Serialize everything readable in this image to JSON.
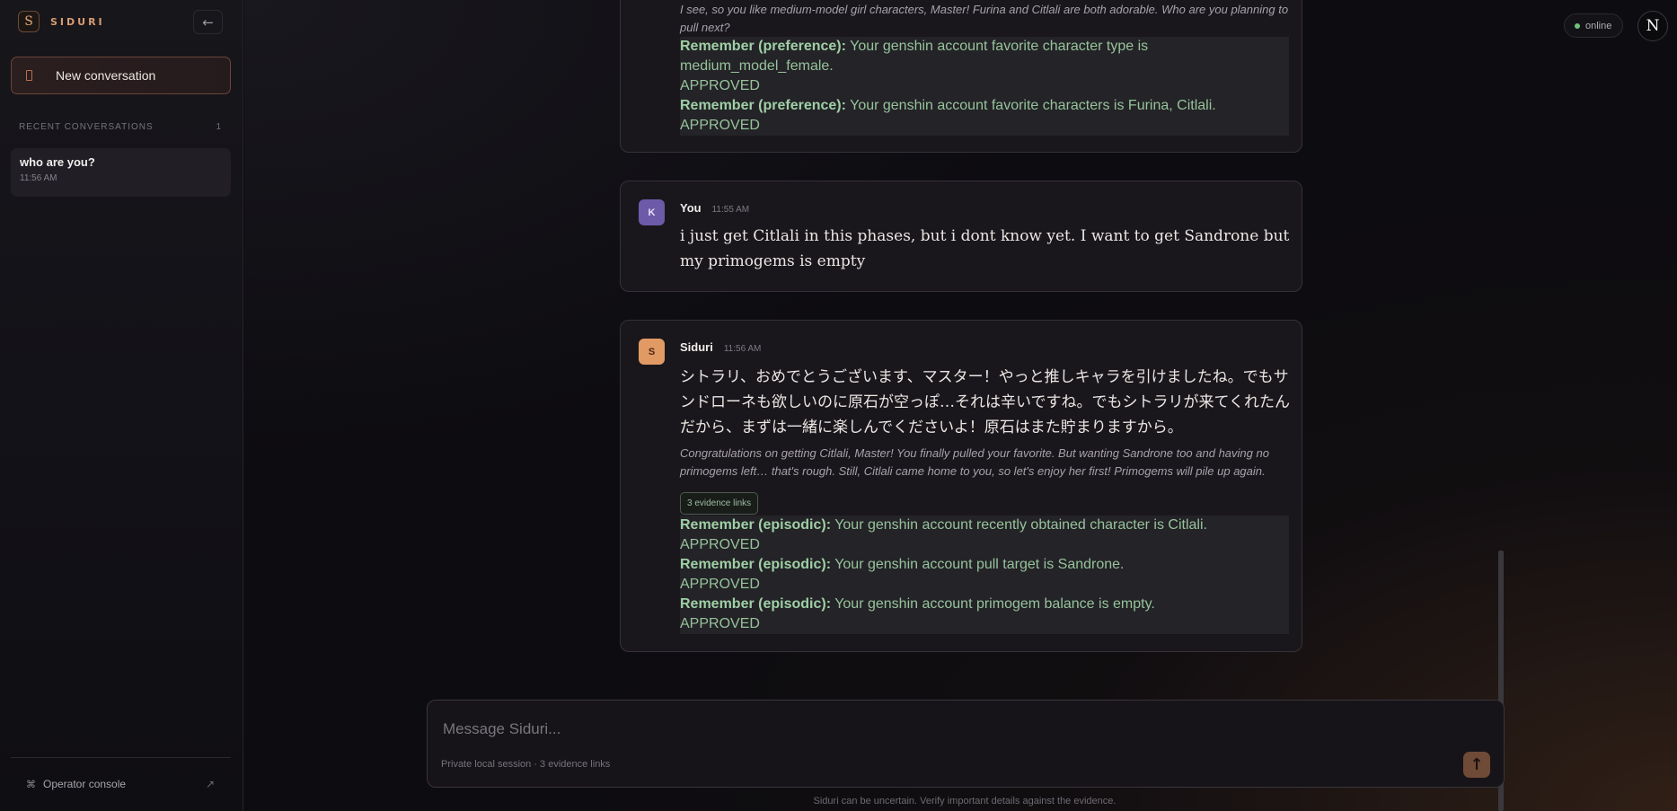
{
  "brand": {
    "mark": "S",
    "name": "SIDURI"
  },
  "sidebar": {
    "collapse_icon": "arrow-left-icon",
    "new_conversation": "New conversation",
    "recent_heading": "RECENT CONVERSATIONS",
    "recent_count": "1",
    "conversations": [
      {
        "title": "who are you?",
        "time": "11:56 AM"
      }
    ],
    "operator_label": "Operator console",
    "operator_icon": "⌘",
    "operator_arrow": "↗"
  },
  "header": {
    "status": "online",
    "user_initial": "N"
  },
  "messages": [
    {
      "italic": "I see, so you like medium-model girl characters, Master! Furina and Citlali are both adorable. Who are you planning to pull next?",
      "memories": [
        {
          "kind": "Remember (preference):",
          "text": " Your genshin account favorite character type is medium_model_female.",
          "status": "APPROVED"
        },
        {
          "kind": "Remember (preference):",
          "text": " Your genshin account favorite characters is Furina, Citlali.",
          "status": "APPROVED"
        }
      ]
    },
    {
      "avatar": "K",
      "author": "You",
      "time": "11:55 AM",
      "text": "i just get Citlali in this phases, but i dont know yet. I want to get Sandrone but my primogems is empty"
    },
    {
      "avatar": "S",
      "author": "Siduri",
      "time": "11:56 AM",
      "text": "シトラリ、おめでとうございます、マスター！やっと推しキャラを引けましたね。でもサンドローネも欲しいのに原石が空っぽ…それは辛いですね。でもシトラリが来てくれたんだから、まずは一緒に楽しんでくださいよ！原石はまた貯まりますから。",
      "italic": "Congratulations on getting Citlali, Master! You finally pulled your favorite. But wanting Sandrone too and having no primogems left… that's rough. Still, Citlali came home to you, so let's enjoy her first! Primogems will pile up again.",
      "evidence": "3 evidence links",
      "memories": [
        {
          "kind": "Remember (episodic):",
          "text": " Your genshin account recently obtained character is Citlali.",
          "status": "APPROVED"
        },
        {
          "kind": "Remember (episodic):",
          "text": " Your genshin account pull target is Sandrone.",
          "status": "APPROVED"
        },
        {
          "kind": "Remember (episodic):",
          "text": " Your genshin account primogem balance is empty.",
          "status": "APPROVED"
        }
      ]
    }
  ],
  "composer": {
    "placeholder": "Message Siduri...",
    "hint": "Private local session · 3 evidence links",
    "send_icon": "arrow-up-icon"
  },
  "disclaimer": "Siduri can be uncertain. Verify important details against the evidence.",
  "colors": {
    "accent": "#e29a65",
    "memory_green": "#96c39c",
    "online": "#6fc37b"
  }
}
